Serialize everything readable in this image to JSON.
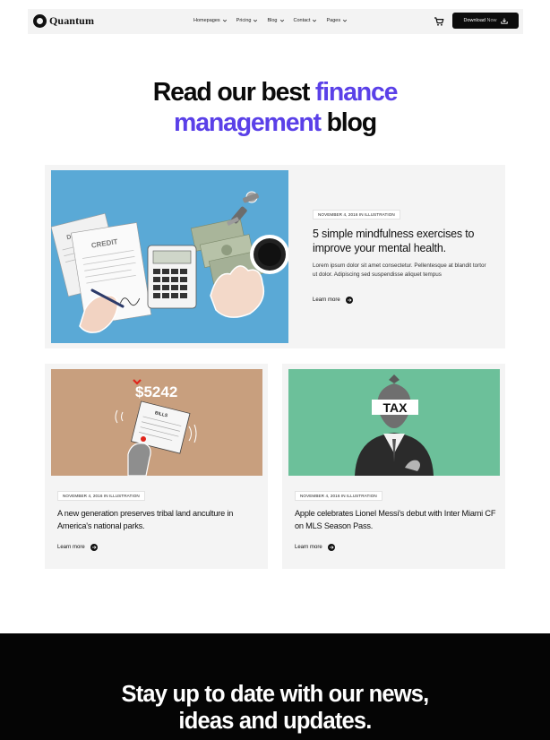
{
  "brand": {
    "name": "Quantum"
  },
  "nav": {
    "items": [
      {
        "label": "Homepages"
      },
      {
        "label": "Pricing"
      },
      {
        "label": "Blog"
      },
      {
        "label": "Contact"
      },
      {
        "label": "Pages"
      }
    ],
    "download_label": "Download",
    "download_suffix": "Now"
  },
  "hero": {
    "line1_plain": "Read our best ",
    "line1_accent": "finance",
    "line2_accent": "management",
    "line2_plain": " blog"
  },
  "posts": {
    "featured": {
      "meta": "November 4, 2016 in Illustration",
      "title": "5 simple mindfulness exercises to improve your mental health.",
      "excerpt": "Lorem ipsum dolor sit amet consectetur. Pellentesque at blandit tortor ut dolor. Adipiscing sed suspendisse aliquet tempus",
      "read_more": "Learn more",
      "image_labels": {
        "debt": "DEBT",
        "credit": "CREDIT"
      }
    },
    "second": {
      "meta": "November 4, 2016 in Illustration",
      "title": "A new generation preserves tribal land anculture in America's national parks.",
      "read_more": "Learn more",
      "image_labels": {
        "amount": "$5242",
        "bills": "BILLS"
      }
    },
    "third": {
      "meta": "November 4, 2016 in Illustration",
      "title": "Apple celebrates Lionel Messi's debut with Inter Miami CF on MLS Season Pass.",
      "read_more": "Learn more",
      "image_labels": {
        "tax": "TAX"
      }
    }
  },
  "newsletter": {
    "line1": "Stay up to date with our news,",
    "line2": "ideas and updates."
  },
  "colors": {
    "accent": "#5a40e8",
    "card_bg": "#f4f4f4",
    "featured_image_bg": "#5aa9d6",
    "tan_image_bg": "#c89f7e",
    "green_image_bg": "#6cc09a",
    "amount_red": "#e0241b",
    "footer_bg": "#050505"
  },
  "icons": [
    "logo-icon",
    "chevron-down-icon",
    "cart-icon",
    "download-icon",
    "arrow-right-icon"
  ]
}
